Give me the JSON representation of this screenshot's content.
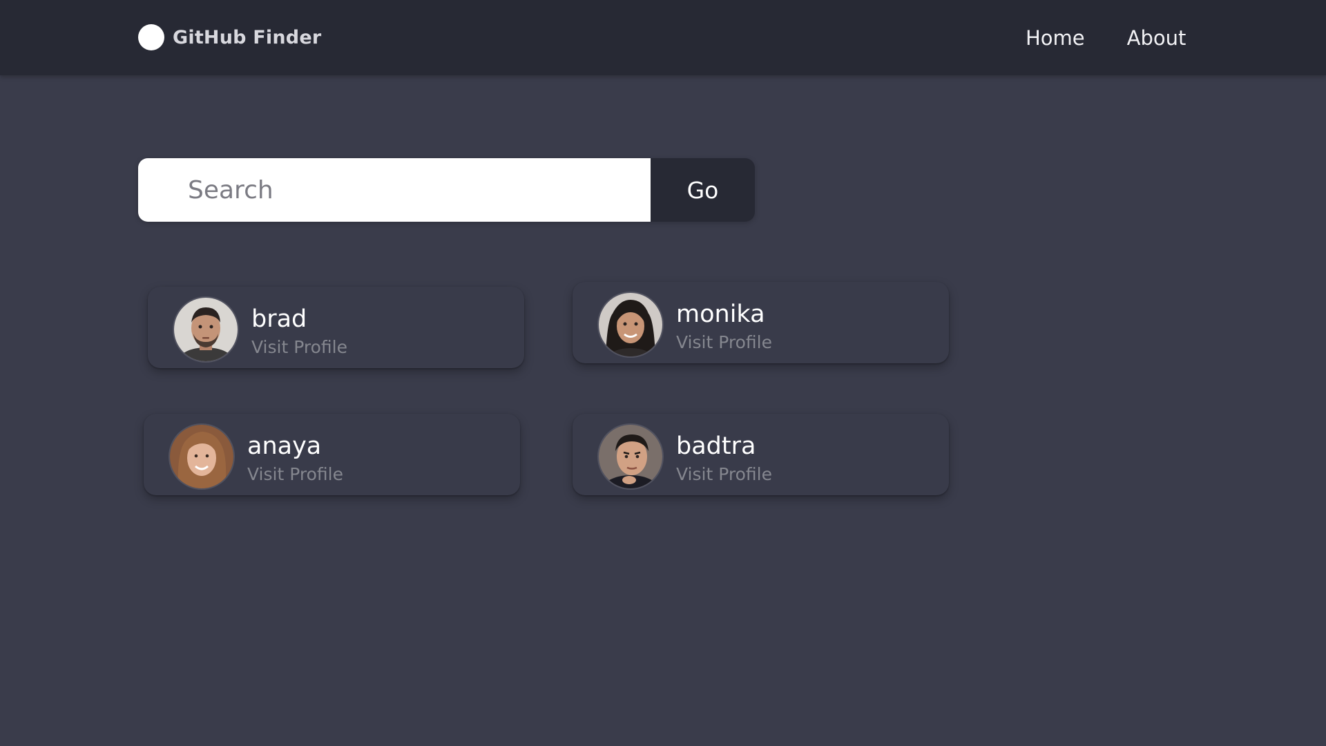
{
  "navbar": {
    "brand_title": "GitHub Finder",
    "brand_icon": "github-logo-icon",
    "links": [
      "Home",
      "About"
    ]
  },
  "search": {
    "placeholder": "Search",
    "value": "",
    "button_label": "Go"
  },
  "users": [
    {
      "username": "brad",
      "link_label": "Visit Profile",
      "avatar_icon": "avatar-photo"
    },
    {
      "username": "monika",
      "link_label": "Visit Profile",
      "avatar_icon": "avatar-photo"
    },
    {
      "username": "anaya",
      "link_label": "Visit Profile",
      "avatar_icon": "avatar-photo"
    },
    {
      "username": "badtra",
      "link_label": "Visit Profile",
      "avatar_icon": "avatar-photo"
    }
  ],
  "colors": {
    "page_background": "#3a3c4b",
    "navbar_background": "#272934",
    "card_background": "#393b4a",
    "muted_text": "#85878f"
  }
}
